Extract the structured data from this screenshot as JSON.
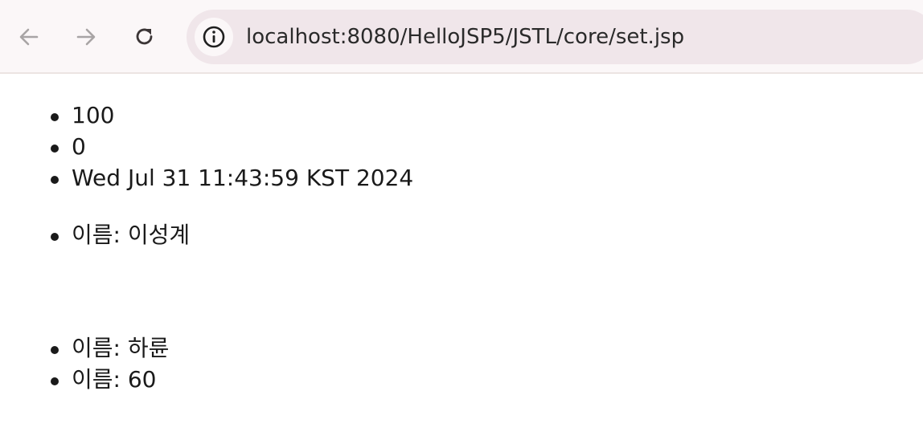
{
  "browser": {
    "url": "localhost:8080/HelloJSP5/JSTL/core/set.jsp"
  },
  "page": {
    "list_1": [
      "100",
      "0",
      "Wed Jul 31 11:43:59 KST 2024"
    ],
    "list_2": [
      "이름: 이성계"
    ],
    "list_3": [
      "이름: 하륜",
      "이름: 60"
    ]
  }
}
